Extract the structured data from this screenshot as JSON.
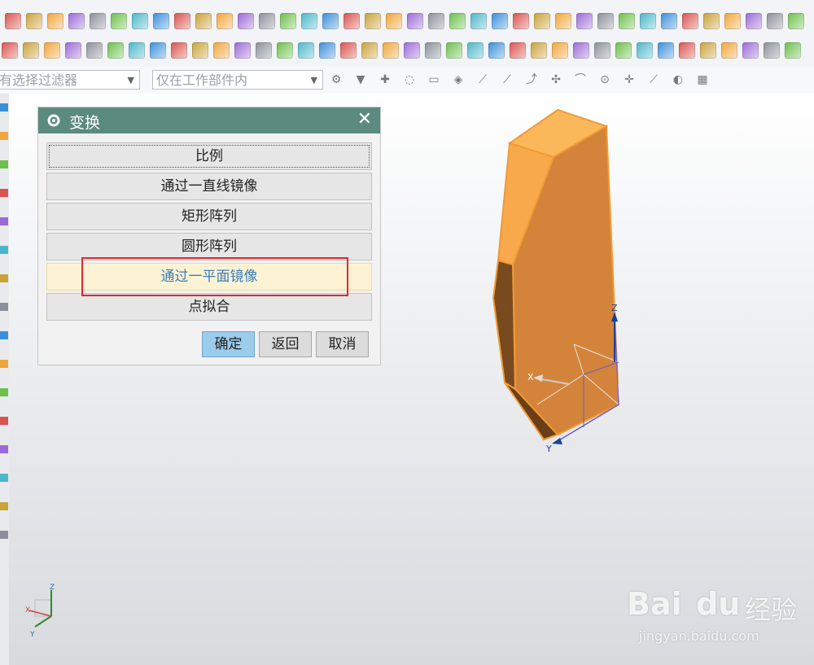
{
  "toolbar": {
    "selection_filter": "有选择过滤器",
    "scope_filter": "仅在工作部件内"
  },
  "dialog": {
    "title": "变换",
    "options": [
      {
        "label": "比例"
      },
      {
        "label": "通过一直线镜像"
      },
      {
        "label": "矩形阵列"
      },
      {
        "label": "圆形阵列"
      },
      {
        "label": "通过一平面镜像"
      },
      {
        "label": "点拟合"
      }
    ],
    "ok_label": "确定",
    "back_label": "返回",
    "cancel_label": "取消"
  },
  "model": {
    "axis_x": "X",
    "axis_y": "Y",
    "axis_z": "Z"
  },
  "triad": {
    "axis_x": "X",
    "axis_y": "Y",
    "axis_z": "Z"
  },
  "watermark": {
    "brand": "Bai",
    "brand2": "du",
    "product": "经验",
    "url": "jingyan.baidu.com"
  },
  "colors": {
    "dialog_title_bg": "#5b8a7e",
    "highlight_row": "#fdf3d4",
    "red_box": "#e0282e",
    "model_orange": "#e8953e",
    "ok_button": "#9ccbec"
  }
}
